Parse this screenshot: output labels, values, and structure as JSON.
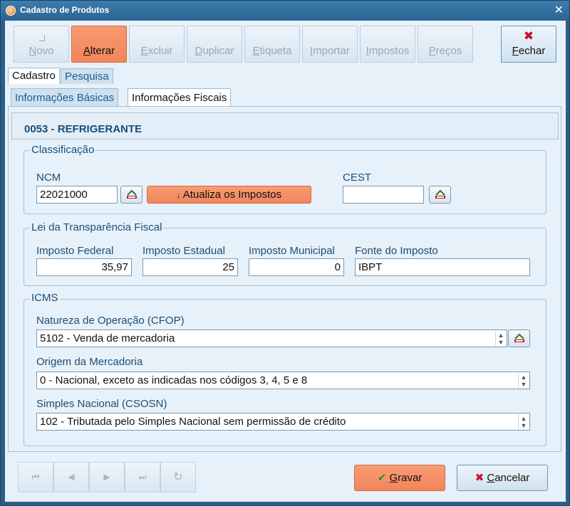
{
  "window": {
    "title": "Cadastro de Produtos",
    "close_symbol": "✕"
  },
  "toolbar": {
    "novo": {
      "prefix": "N",
      "rest": "ovo"
    },
    "alterar": {
      "prefix": "A",
      "rest": "lterar"
    },
    "excluir": {
      "prefix": "E",
      "rest": "xcluir"
    },
    "duplicar": {
      "prefix": "D",
      "rest": "uplicar"
    },
    "etiqueta": {
      "prefix": "E",
      "rest": "tiqueta"
    },
    "importar": {
      "prefix": "I",
      "rest": "mportar"
    },
    "impostos": {
      "prefix": "I",
      "rest": "mpostos"
    },
    "precos": {
      "prefix": "P",
      "rest": "reços"
    },
    "fechar": {
      "prefix": "F",
      "rest": "echar"
    }
  },
  "tabs": {
    "main": [
      "Cadastro",
      "Pesquisa"
    ],
    "sub": [
      "Informações Básicas",
      "Informações Fiscais"
    ]
  },
  "product": {
    "title": "0053 - REFRIGERANTE"
  },
  "classificacao": {
    "legend": "Classificação",
    "ncm_label": "NCM",
    "ncm_value": "22021000",
    "update_button": "Atualiza os Impostos",
    "update_icon": "↓",
    "cest_label": "CEST",
    "cest_value": ""
  },
  "lei": {
    "legend": "Lei da Transparência Fiscal",
    "federal_label": "Imposto Federal",
    "federal_value": "35,97",
    "estadual_label": "Imposto Estadual",
    "estadual_value": "25",
    "municipal_label": "Imposto Municipal",
    "municipal_value": "0",
    "fonte_label": "Fonte do Imposto",
    "fonte_value": "IBPT"
  },
  "icms": {
    "legend": "ICMS",
    "cfop_label": "Natureza de Operação (CFOP)",
    "cfop_value": "5102 - Venda de mercadoria",
    "origem_label": "Origem da Mercadoria",
    "origem_value": "0 - Nacional, exceto as indicadas nos códigos 3, 4, 5 e 8",
    "csosn_label": "Simples Nacional (CSOSN)",
    "csosn_value": "102 - Tributada pelo Simples Nacional sem permissão de crédito"
  },
  "footer": {
    "gravar": {
      "prefix": "G",
      "rest": "ravar",
      "icon": "✔"
    },
    "cancelar": {
      "prefix": "C",
      "rest": "ancelar",
      "icon": "✖"
    }
  },
  "colors": {
    "accent": "#f2855a",
    "title_bar": "#2a6494",
    "text_blue": "#1d4d74"
  }
}
